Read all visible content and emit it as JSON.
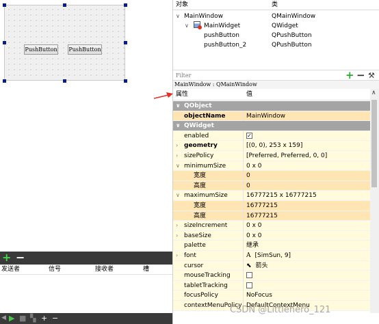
{
  "designer": {
    "buttons": [
      {
        "label": "PushButton"
      },
      {
        "label": "PushButton"
      }
    ]
  },
  "signal_slot": {
    "columns": [
      "发送者",
      "信号",
      "接收者",
      "槽"
    ]
  },
  "object_inspector": {
    "columns": [
      "对象",
      "类"
    ],
    "tree": [
      {
        "object": "MainWindow",
        "class": "QMainWindow"
      },
      {
        "object": "MainWidget",
        "class": "QWidget"
      },
      {
        "object": "pushButton",
        "class": "QPushButton"
      },
      {
        "object": "pushButton_2",
        "class": "QPushButton"
      }
    ]
  },
  "property_editor": {
    "filter_placeholder": "Filter",
    "class_line": "MainWindow : QMainWindow",
    "columns": [
      "属性",
      "值"
    ],
    "sections": {
      "qobject": "QObject",
      "qwidget": "QWidget"
    },
    "rows": {
      "objectName": {
        "name": "objectName",
        "value": "MainWindow"
      },
      "enabled": {
        "name": "enabled",
        "value": "✓"
      },
      "geometry": {
        "name": "geometry",
        "value": "[(0, 0), 253 x 159]"
      },
      "sizePolicy": {
        "name": "sizePolicy",
        "value": "[Preferred, Preferred, 0, 0]"
      },
      "minimumSize": {
        "name": "minimumSize",
        "value": "0 x 0"
      },
      "minWidth": {
        "name": "宽度",
        "value": "0"
      },
      "minHeight": {
        "name": "高度",
        "value": "0"
      },
      "maximumSize": {
        "name": "maximumSize",
        "value": "16777215 x 16777215"
      },
      "maxWidth": {
        "name": "宽度",
        "value": "16777215"
      },
      "maxHeight": {
        "name": "高度",
        "value": "16777215"
      },
      "sizeIncrement": {
        "name": "sizeIncrement",
        "value": "0 x 0"
      },
      "baseSize": {
        "name": "baseSize",
        "value": "0 x 0"
      },
      "palette": {
        "name": "palette",
        "value": "继承"
      },
      "font": {
        "name": "font",
        "value": "[SimSun, 9]"
      },
      "cursor": {
        "name": "cursor",
        "value": "箭头"
      },
      "mouseTracking": {
        "name": "mouseTracking",
        "value": ""
      },
      "tabletTracking": {
        "name": "tabletTracking",
        "value": ""
      },
      "focusPolicy": {
        "name": "focusPolicy",
        "value": "NoFocus"
      },
      "contextMenuPolicy": {
        "name": "contextMenuPolicy",
        "value": "DefaultContextMenu"
      }
    }
  },
  "watermark": "CSDN @Littlehero_121",
  "colors": {
    "section_bg": "#a4a4a4",
    "row_yellow": "#fffbdc",
    "row_orange": "#ffe5b4",
    "selection_handle": "#0a1e86",
    "arrow_red": "#e0302a"
  }
}
